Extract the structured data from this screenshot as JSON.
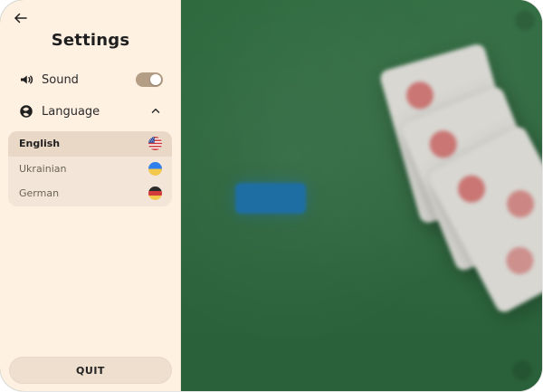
{
  "panel": {
    "title": "Settings",
    "sound": {
      "label": "Sound",
      "enabled": true
    },
    "language": {
      "label": "Language",
      "expanded": true,
      "selected": "English",
      "options": [
        {
          "label": "English",
          "flag": "us-flag-icon"
        },
        {
          "label": "Ukrainian",
          "flag": "ukraine-flag-icon"
        },
        {
          "label": "German",
          "flag": "germany-flag-icon"
        }
      ]
    },
    "quit_label": "QUIT"
  },
  "icons": {
    "back": "back-arrow-icon",
    "sound": "speaker-icon",
    "language": "globe-icon",
    "collapse": "chevron-up-icon"
  },
  "colors": {
    "panel_bg": "#fff1e2",
    "game_bg": "#2f6b3f",
    "toggle_bg": "#b59e86",
    "lang_list_bg": "#f3e6d8",
    "lang_selected_bg": "#ead8c6",
    "quit_bg": "#efdfcf"
  }
}
